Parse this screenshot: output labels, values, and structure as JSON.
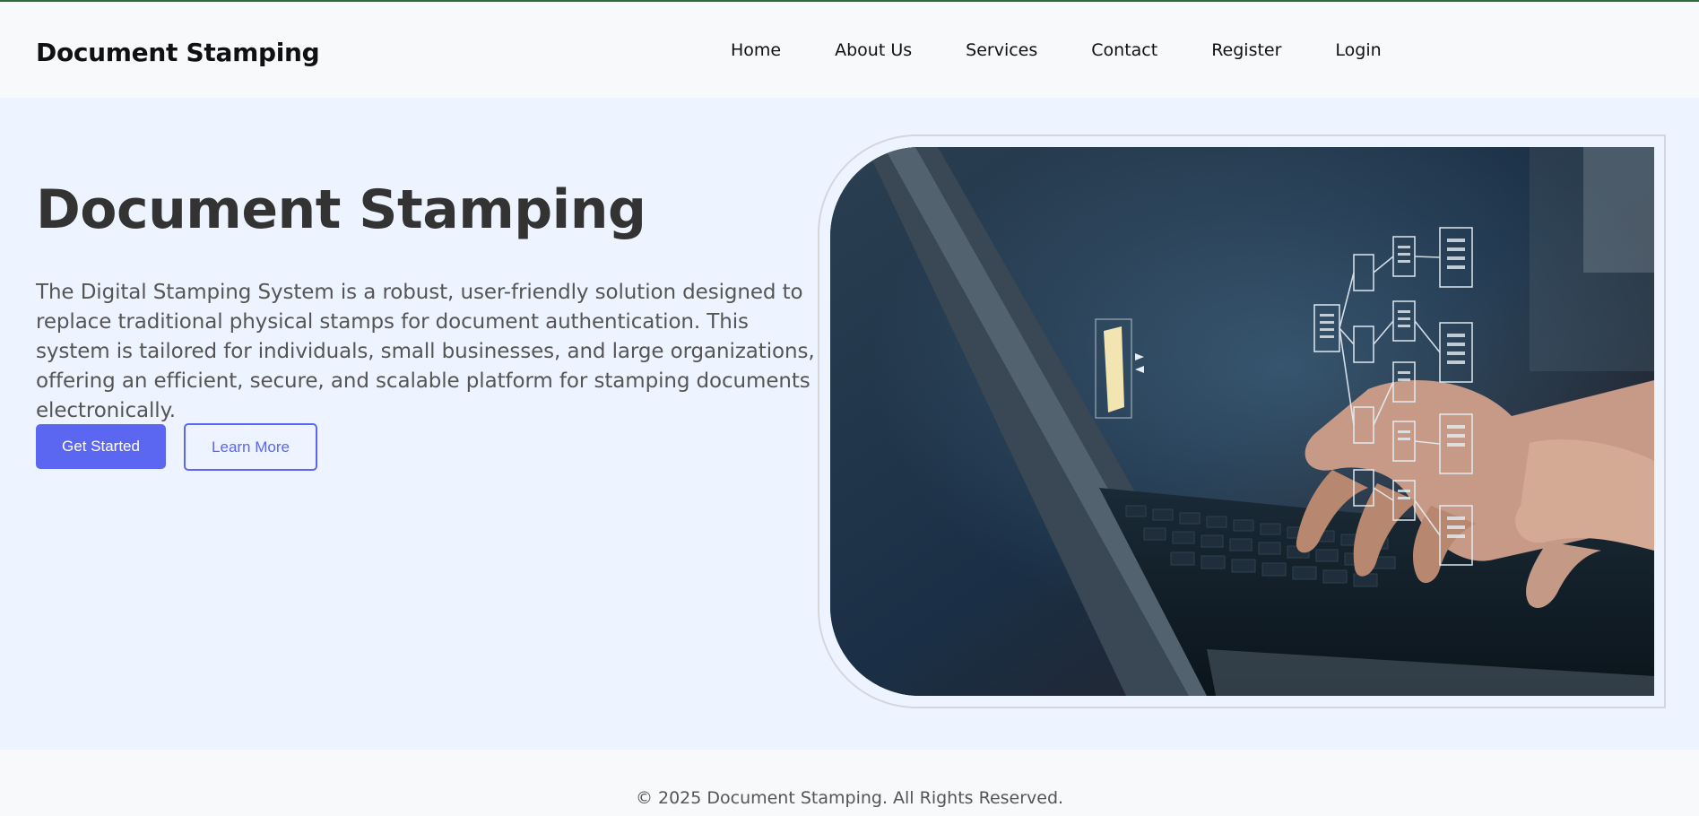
{
  "header": {
    "brand": "Document Stamping",
    "nav": [
      {
        "label": "Home"
      },
      {
        "label": "About Us"
      },
      {
        "label": "Services"
      },
      {
        "label": "Contact"
      },
      {
        "label": "Register"
      },
      {
        "label": "Login"
      }
    ]
  },
  "hero": {
    "title": "Document Stamping",
    "description": "The Digital Stamping System is a robust, user-friendly solution designed to replace traditional physical stamps for document authentication. This system is tailored for individuals, small businesses, and large organizations, offering an efficient, secure, and scalable platform for stamping documents electronically.",
    "primary_button": "Get Started",
    "secondary_button": "Learn More",
    "image_icon": "laptop-typing-with-document-hierarchy-illustration"
  },
  "footer": {
    "copyright": "© 2025 Document Stamping. All Rights Reserved."
  },
  "colors": {
    "accent": "#5b67f1",
    "hero_background": "#eef4ff",
    "top_border": "#2e6b3a"
  }
}
